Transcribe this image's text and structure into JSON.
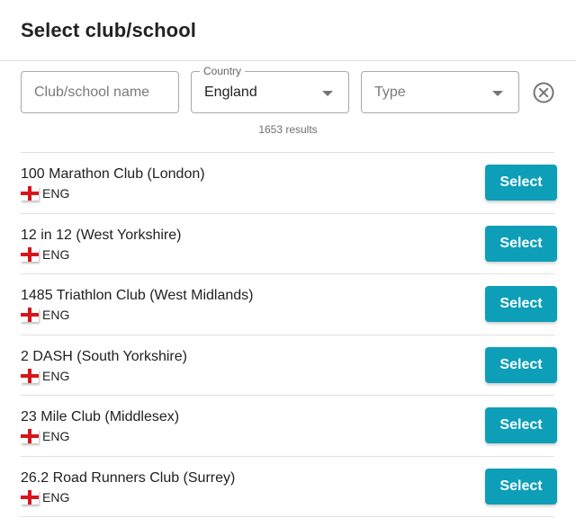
{
  "dialog": {
    "title": "Select club/school"
  },
  "filters": {
    "name_placeholder": "Club/school name",
    "country_label": "Country",
    "country_value": "England",
    "type_placeholder": "Type"
  },
  "results_text": "1653 results",
  "select_label": "Select",
  "colors": {
    "accent": "#0e9fb8",
    "flag_red": "#d8141c"
  },
  "clubs": [
    {
      "name": "100 Marathon Club (London)",
      "code": "ENG"
    },
    {
      "name": "12 in 12 (West Yorkshire)",
      "code": "ENG"
    },
    {
      "name": "1485 Triathlon Club (West Midlands)",
      "code": "ENG"
    },
    {
      "name": "2 DASH (South Yorkshire)",
      "code": "ENG"
    },
    {
      "name": "23 Mile Club (Middlesex)",
      "code": "ENG"
    },
    {
      "name": "26.2 Road Runners Club (Surrey)",
      "code": "ENG"
    }
  ]
}
